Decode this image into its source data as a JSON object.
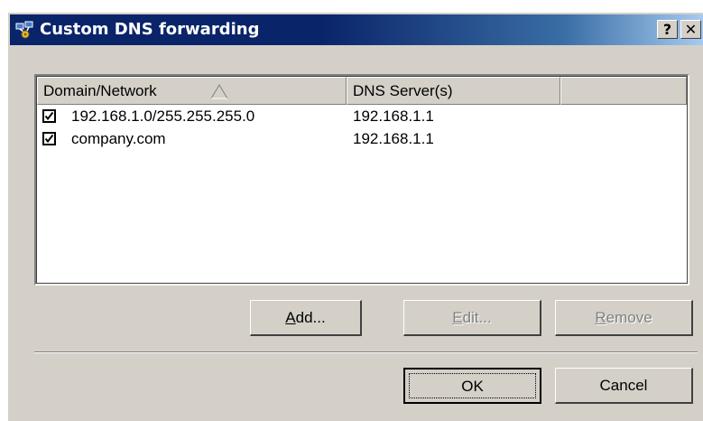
{
  "window": {
    "title": "Custom DNS forwarding",
    "title_icon": "network-gear-icon",
    "help_label": "?",
    "close_label": "✕"
  },
  "list": {
    "columns": [
      {
        "label": "Domain/Network",
        "sort": "ascending"
      },
      {
        "label": "DNS Server(s)"
      },
      {
        "label": ""
      }
    ],
    "rows": [
      {
        "checked": true,
        "domain": "192.168.1.0/255.255.255.0",
        "dns": "192.168.1.1"
      },
      {
        "checked": true,
        "domain": "company.com",
        "dns": "192.168.1.1"
      }
    ]
  },
  "buttons": {
    "add": {
      "mnemonic": "A",
      "rest": "dd..."
    },
    "edit": {
      "mnemonic": "E",
      "rest": "dit...",
      "disabled": true
    },
    "remove": {
      "mnemonic": "R",
      "rest": "emove",
      "disabled": true
    },
    "ok": "OK",
    "cancel": "Cancel"
  },
  "colors": {
    "title_bar_start": "#0a246a",
    "title_bar_end": "#a6caf0",
    "dialog_face": "#d4d0c8"
  }
}
